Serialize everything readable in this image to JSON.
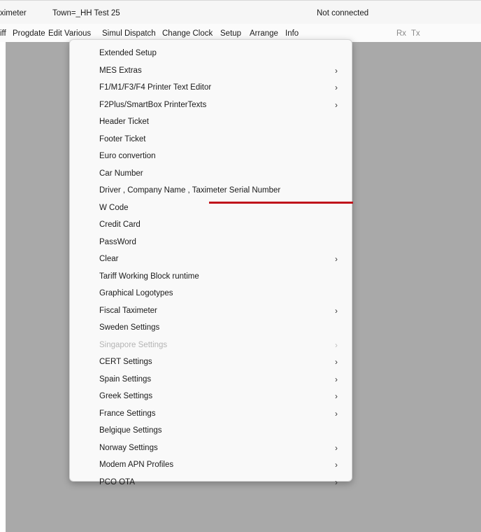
{
  "window": {
    "app_name": "ximeter",
    "town": "Town=_HH Test 25",
    "status": "Not connected"
  },
  "menubar": {
    "items": [
      {
        "label": "iff"
      },
      {
        "label": "Progdate"
      },
      {
        "label": "Edit Various"
      },
      {
        "label": "Simul Dispatch"
      },
      {
        "label": "Change Clock"
      },
      {
        "label": "Setup"
      },
      {
        "label": "Arrange"
      },
      {
        "label": "Info"
      }
    ],
    "rx": "Rx",
    "tx": "Tx"
  },
  "dropdown": {
    "items": [
      {
        "label": "Extended Setup",
        "has_submenu": false,
        "disabled": false
      },
      {
        "label": "MES Extras",
        "has_submenu": true,
        "disabled": false
      },
      {
        "label": "F1/M1/F3/F4 Printer Text Editor",
        "has_submenu": true,
        "disabled": false
      },
      {
        "label": "F2Plus/SmartBox PrinterTexts",
        "has_submenu": true,
        "disabled": false
      },
      {
        "label": "Header Ticket",
        "has_submenu": false,
        "disabled": false
      },
      {
        "label": "Footer Ticket",
        "has_submenu": false,
        "disabled": false
      },
      {
        "label": "Euro convertion",
        "has_submenu": false,
        "disabled": false
      },
      {
        "label": "Car Number",
        "has_submenu": false,
        "disabled": false
      },
      {
        "label": "Driver , Company Name , Taximeter Serial Number",
        "has_submenu": false,
        "disabled": false
      },
      {
        "label": "W Code",
        "has_submenu": false,
        "disabled": false
      },
      {
        "label": "Credit Card",
        "has_submenu": false,
        "disabled": false
      },
      {
        "label": "PassWord",
        "has_submenu": false,
        "disabled": false
      },
      {
        "label": "Clear",
        "has_submenu": true,
        "disabled": false
      },
      {
        "label": "Tariff Working Block runtime",
        "has_submenu": false,
        "disabled": false
      },
      {
        "label": "Graphical Logotypes",
        "has_submenu": false,
        "disabled": false
      },
      {
        "label": "Fiscal Taximeter",
        "has_submenu": true,
        "disabled": false
      },
      {
        "label": "Sweden Settings",
        "has_submenu": false,
        "disabled": false
      },
      {
        "label": "Singapore Settings",
        "has_submenu": true,
        "disabled": true
      },
      {
        "label": "CERT Settings",
        "has_submenu": true,
        "disabled": false
      },
      {
        "label": "Spain Settings",
        "has_submenu": true,
        "disabled": false
      },
      {
        "label": "Greek Settings",
        "has_submenu": true,
        "disabled": false
      },
      {
        "label": "France Settings",
        "has_submenu": true,
        "disabled": false
      },
      {
        "label": "Belgique Settings",
        "has_submenu": false,
        "disabled": false
      },
      {
        "label": "Norway Settings",
        "has_submenu": true,
        "disabled": false
      },
      {
        "label": "Modem APN Profiles",
        "has_submenu": true,
        "disabled": false
      },
      {
        "label": "PCO OTA",
        "has_submenu": true,
        "disabled": false
      }
    ],
    "submenu_glyph": "›"
  },
  "colors": {
    "workspace": "#a9a9a9",
    "menu_background": "#f9f9f9",
    "annotation_underline": "#c0141c",
    "disabled_text": "#b4b4b4"
  }
}
